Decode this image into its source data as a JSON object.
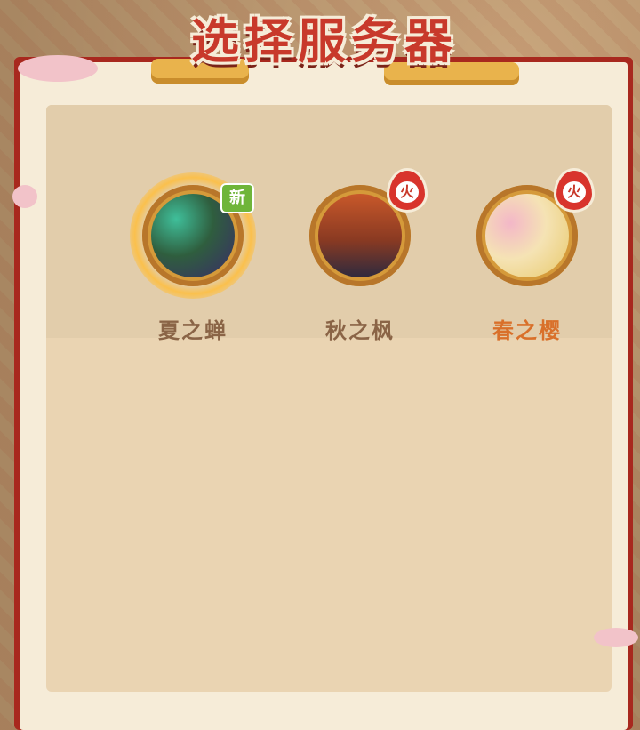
{
  "title": "选择服务器",
  "servers": [
    {
      "name": "夏之蝉",
      "badge": "新",
      "badge_type": "new",
      "name_color": "#8a6446",
      "selected": true,
      "theme": [
        "#2f5e3e",
        "#4a7a3e",
        "#3a2a6a"
      ]
    },
    {
      "name": "秋之枫",
      "badge": "火",
      "badge_type": "hot",
      "name_color": "#8a6446",
      "selected": false,
      "theme": [
        "#8a3a22",
        "#c8582a",
        "#2e2a3e"
      ]
    },
    {
      "name": "春之樱",
      "badge": "火",
      "badge_type": "hot",
      "name_color": "#d9702a",
      "selected": false,
      "theme": [
        "#f5e3b4",
        "#f3b7c8",
        "#e8c96a"
      ]
    }
  ],
  "colors": {
    "frame": "#a8281e",
    "panel": "#ead4b2",
    "title": "#c8392b"
  }
}
